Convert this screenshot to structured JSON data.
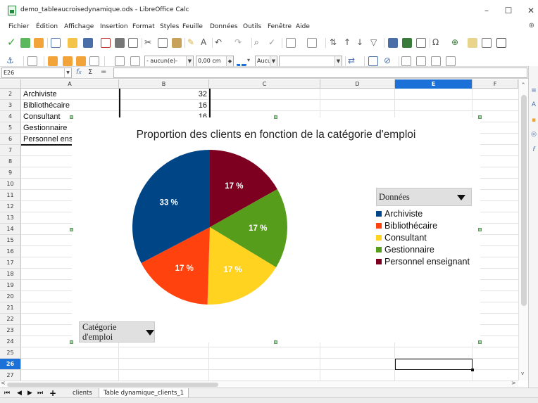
{
  "window": {
    "title": "demo_tableaucroisedynamique.ods - LibreOffice Calc",
    "minimize": "–",
    "maximize": "☐",
    "close": "✕"
  },
  "menu": {
    "items": [
      "Fichier",
      "Édition",
      "Affichage",
      "Insertion",
      "Format",
      "Styles",
      "Feuille",
      "Données",
      "Outils",
      "Fenêtre",
      "Aide"
    ]
  },
  "toolbar2": {
    "line_style": "- aucun(e)-",
    "line_width": "0,00 cm",
    "area_style": "Aucun(e)"
  },
  "formula_bar": {
    "cell_ref": "E26",
    "fx": "f",
    "sub": "x",
    "sum": "Σ",
    "equals": "="
  },
  "grid": {
    "columns": [
      "A",
      "B",
      "C",
      "D",
      "E",
      "F"
    ],
    "active_column": "E",
    "rows": [
      "2",
      "3",
      "4",
      "5",
      "6",
      "7",
      "8",
      "9",
      "10",
      "11",
      "12",
      "13",
      "14",
      "15",
      "16",
      "17",
      "18",
      "19",
      "20",
      "21",
      "22",
      "23",
      "24",
      "25",
      "26",
      "27"
    ],
    "active_row": "26",
    "cells": [
      {
        "label": "Archiviste",
        "value": "32"
      },
      {
        "label": "Bibliothécaire",
        "value": "16"
      },
      {
        "label": "Consultant",
        "value": "16"
      },
      {
        "label": "Gestionnaire",
        "value": ""
      },
      {
        "label": "Personnel enseignant",
        "value": ""
      }
    ]
  },
  "chart_data": {
    "type": "pie",
    "title": "Proportion des clients en fonction de la catégorie d'emploi",
    "categories": [
      "Archiviste",
      "Bibliothécaire",
      "Consultant",
      "Gestionnaire",
      "Personnel enseignant"
    ],
    "values": [
      33,
      17,
      17,
      17,
      17
    ],
    "labels": [
      "33 %",
      "17 %",
      "17 %",
      "17 %",
      "17 %"
    ],
    "colors": [
      "#004586",
      "#ff420e",
      "#ffd320",
      "#579d1c",
      "#7e0021"
    ],
    "legend_placement": "right"
  },
  "pivot": {
    "data_button": "Données",
    "category_button_line1": "Catégorie",
    "category_button_line2": "d'emploi"
  },
  "sheets": {
    "tabs": [
      "clients",
      "Table dynamique_clients_1"
    ],
    "active": "Table dynamique_clients_1",
    "add": "+"
  }
}
